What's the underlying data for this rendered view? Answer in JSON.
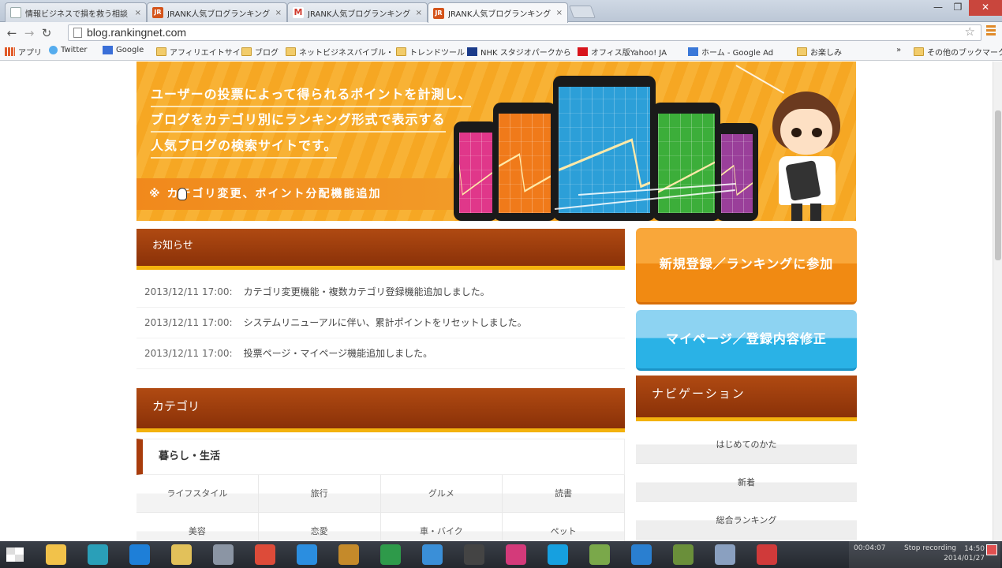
{
  "browser": {
    "tabs": [
      {
        "title": "情報ビジネスで損を救う相談",
        "favicon": "doc",
        "active": false
      },
      {
        "title": "JRANK人気ブログランキング",
        "favicon": "jrank",
        "active": false
      },
      {
        "title": "JRANK人気ブログランキング",
        "favicon": "gmail",
        "active": false
      },
      {
        "title": "JRANK人気ブログランキング",
        "favicon": "jrank",
        "active": true
      }
    ],
    "tab_close": "×",
    "url": "blog.rankingnet.com",
    "bookmarks": [
      {
        "label": "アプリ",
        "icon": "apps"
      },
      {
        "label": "Twitter",
        "icon": "twitter"
      },
      {
        "label": "Google",
        "icon": "google"
      },
      {
        "label": "アフィリエイトサイト",
        "icon": "folder"
      },
      {
        "label": "ブログ",
        "icon": "folder"
      },
      {
        "label": "ネットビジネスバイブル・",
        "icon": "folder"
      },
      {
        "label": "トレンドツール",
        "icon": "folder"
      },
      {
        "label": "NHK スタジオパークから",
        "icon": "nhk"
      },
      {
        "label": "オフィス版Yahoo! JA",
        "icon": "yahoo"
      },
      {
        "label": "ホーム - Google Ad",
        "icon": "google-ads"
      },
      {
        "label": "お楽しみ",
        "icon": "folder"
      },
      {
        "label": "その他のブックマーク",
        "icon": "folder"
      }
    ],
    "bookmarks_overflow": "»"
  },
  "banner": {
    "lines": [
      "ユーザーの投票によって得られるポイントを計測し、",
      "ブログをカテゴリ別にランキング形式で表示する",
      "人気ブログの検索サイトです。"
    ],
    "notice": "※ カテゴリ変更、ポイント分配機能追加",
    "phone_colors": [
      "#e0378a",
      "#f07a1a",
      "#2c9fd8",
      "#3cae3a",
      "#9a3f9a"
    ]
  },
  "notices": {
    "title": "お知らせ",
    "items": [
      {
        "date": "2013/12/11 17:00:",
        "text": "カテゴリ変更機能・複数カテゴリ登録機能追加しました。"
      },
      {
        "date": "2013/12/11 17:00:",
        "text": "システムリニューアルに伴い、累計ポイントをリセットしました。"
      },
      {
        "date": "2013/12/11 17:00:",
        "text": "投票ページ・マイページ機能追加しました。"
      }
    ]
  },
  "categories": {
    "title": "カテゴリ",
    "group": "暮らし・生活",
    "items": [
      "ライフスタイル",
      "旅行",
      "グルメ",
      "読書",
      "美容",
      "恋愛",
      "車・バイク",
      "ペット"
    ]
  },
  "sidebar": {
    "register_label": "新規登録／ランキングに参加",
    "mypage_label": "マイページ／登録内容修正",
    "nav_title": "ナビゲーション",
    "nav_items": [
      "はじめてのかた",
      "新着",
      "総合ランキング"
    ]
  },
  "taskbar": {
    "apps": [
      "explorer",
      "app",
      "ie-blue",
      "note",
      "j-app",
      "chrome",
      "ie",
      "app-colors",
      "app-green",
      "app-wave",
      "app-film",
      "app-pink",
      "skype",
      "app-tools",
      "app-earth",
      "app-cross",
      "app-pad",
      "app-red"
    ],
    "recorder_time": "00:04:07",
    "recorder_label": "Stop recording",
    "clock_time": "14:50",
    "clock_date": "2014/01/27"
  }
}
